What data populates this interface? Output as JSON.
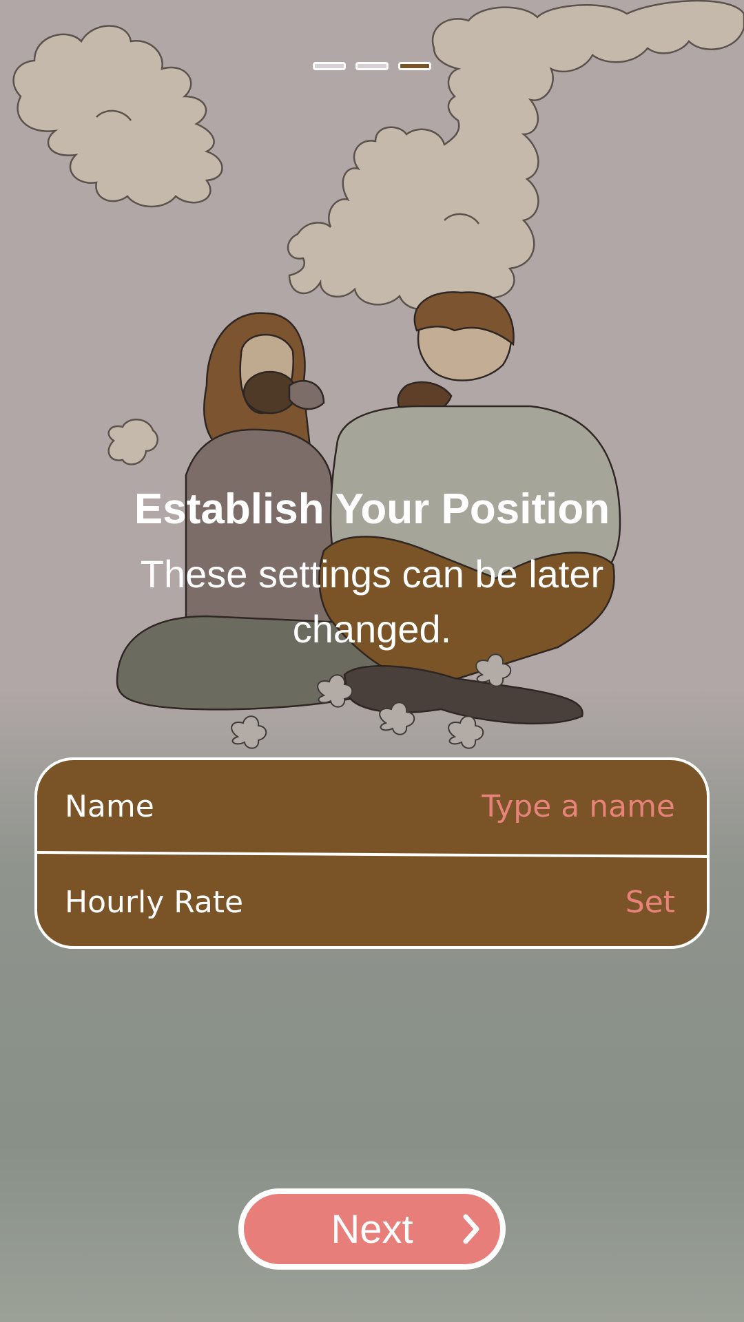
{
  "pager": {
    "total_pages": 3,
    "current_page": 3
  },
  "illustration": {
    "icon": "couple-drinking-coffee-illustration"
  },
  "header": {
    "title": "Establish Your Position",
    "subtitle": "These settings can be later changed."
  },
  "settings": {
    "rows": [
      {
        "label": "Name",
        "value": "Type a name"
      },
      {
        "label": "Hourly Rate",
        "value": "Set"
      }
    ]
  },
  "footer": {
    "next_label": "Next",
    "next_icon": "chevron-right-icon"
  },
  "colors": {
    "background_top": "#b0a7a6",
    "background_bottom": "#889087",
    "card": "#7a5427",
    "accent": "#e77e7a",
    "pager_active": "#7a5326",
    "pager_inactive": "#d8cfd4"
  }
}
